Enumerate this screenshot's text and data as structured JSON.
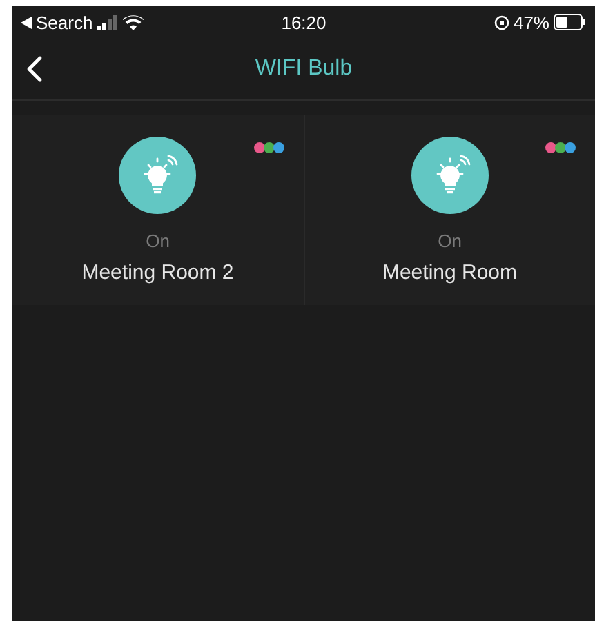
{
  "status_bar": {
    "back_label": "Search",
    "time": "16:20",
    "battery": "47%"
  },
  "nav": {
    "title": "WIFI Bulb"
  },
  "devices": [
    {
      "status": "On",
      "name": "Meeting Room 2"
    },
    {
      "status": "On",
      "name": "Meeting Room"
    }
  ]
}
